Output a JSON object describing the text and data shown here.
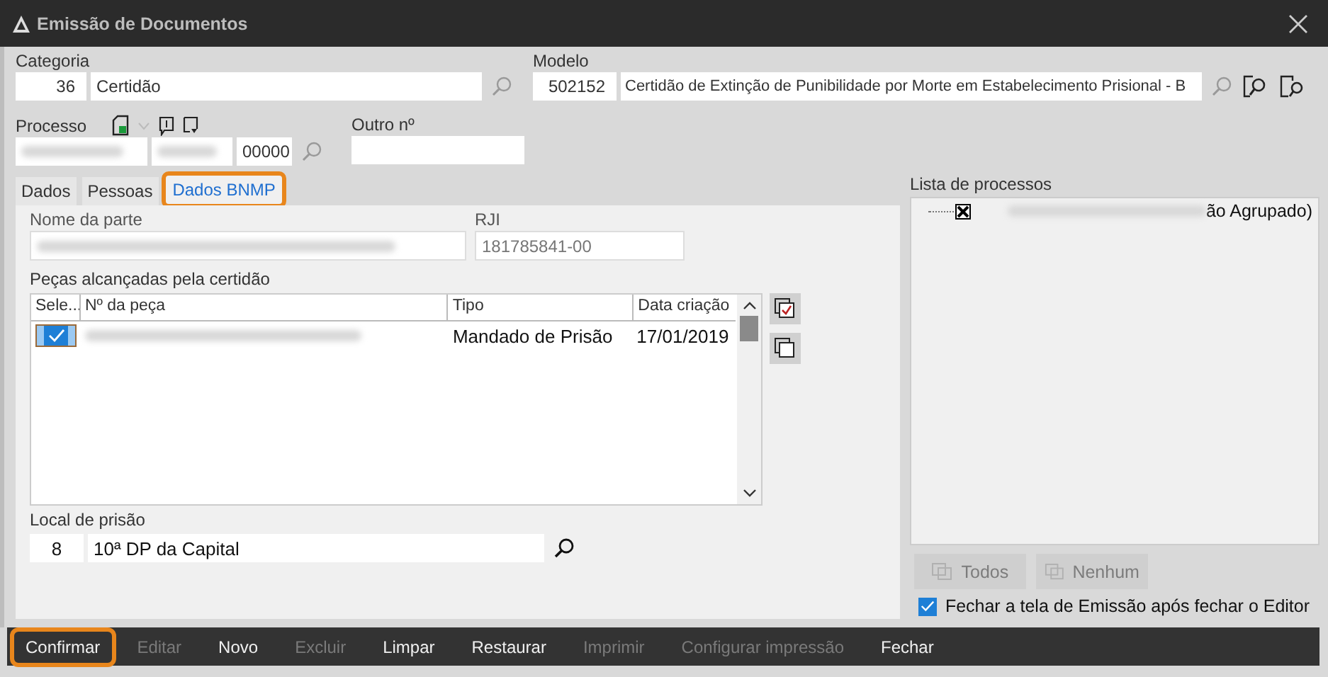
{
  "window": {
    "title": "Emissão de Documentos"
  },
  "categoria": {
    "label": "Categoria",
    "code": "36",
    "name": "Certidão"
  },
  "modelo": {
    "label": "Modelo",
    "code": "502152",
    "name": "Certidão de Extinção de Punibilidade por Morte em Estabelecimento Prisional - B"
  },
  "processo": {
    "label": "Processo",
    "suffix": "00000"
  },
  "outro_numero": {
    "label": "Outro nº"
  },
  "tabs": [
    {
      "label": "Dados",
      "selected": false,
      "highlighted": false
    },
    {
      "label": "Pessoas",
      "selected": false,
      "highlighted": false
    },
    {
      "label": "Dados BNMP",
      "selected": true,
      "highlighted": true
    }
  ],
  "nome_parte": {
    "label": "Nome da parte"
  },
  "rji": {
    "label": "RJI",
    "value": "181785841-00"
  },
  "pecas": {
    "label": "Peças alcançadas pela certidão",
    "columns": [
      "Sele...",
      "Nº da peça",
      "Tipo",
      "Data criação"
    ],
    "rows": [
      {
        "selected": true,
        "tipo": "Mandado de Prisão",
        "data": "17/01/2019"
      }
    ]
  },
  "local_prisao": {
    "label": "Local de prisão",
    "code": "8",
    "name": "10ª DP da Capital"
  },
  "lista_processos": {
    "label": "Lista de processos",
    "items": [
      {
        "checked": true,
        "text": "ão Agrupado)"
      }
    ]
  },
  "list_buttons": [
    {
      "label": "Todos",
      "disabled": true
    },
    {
      "label": "Nenhum",
      "disabled": true
    }
  ],
  "close_option": {
    "label": "Fechar a tela de Emissão após fechar o Editor",
    "checked": true
  },
  "toolbar": [
    {
      "label": "Confirmar",
      "disabled": false,
      "highlighted": true
    },
    {
      "label": "Editar",
      "disabled": true,
      "highlighted": false
    },
    {
      "label": "Novo",
      "disabled": false,
      "highlighted": false
    },
    {
      "label": "Excluir",
      "disabled": true,
      "highlighted": false
    },
    {
      "label": "Limpar",
      "disabled": false,
      "highlighted": false
    },
    {
      "label": "Restaurar",
      "disabled": false,
      "highlighted": false
    },
    {
      "label": "Imprimir",
      "disabled": true,
      "highlighted": false
    },
    {
      "label": "Configurar impressão",
      "disabled": true,
      "highlighted": false
    },
    {
      "label": "Fechar",
      "disabled": false,
      "highlighted": false
    }
  ]
}
